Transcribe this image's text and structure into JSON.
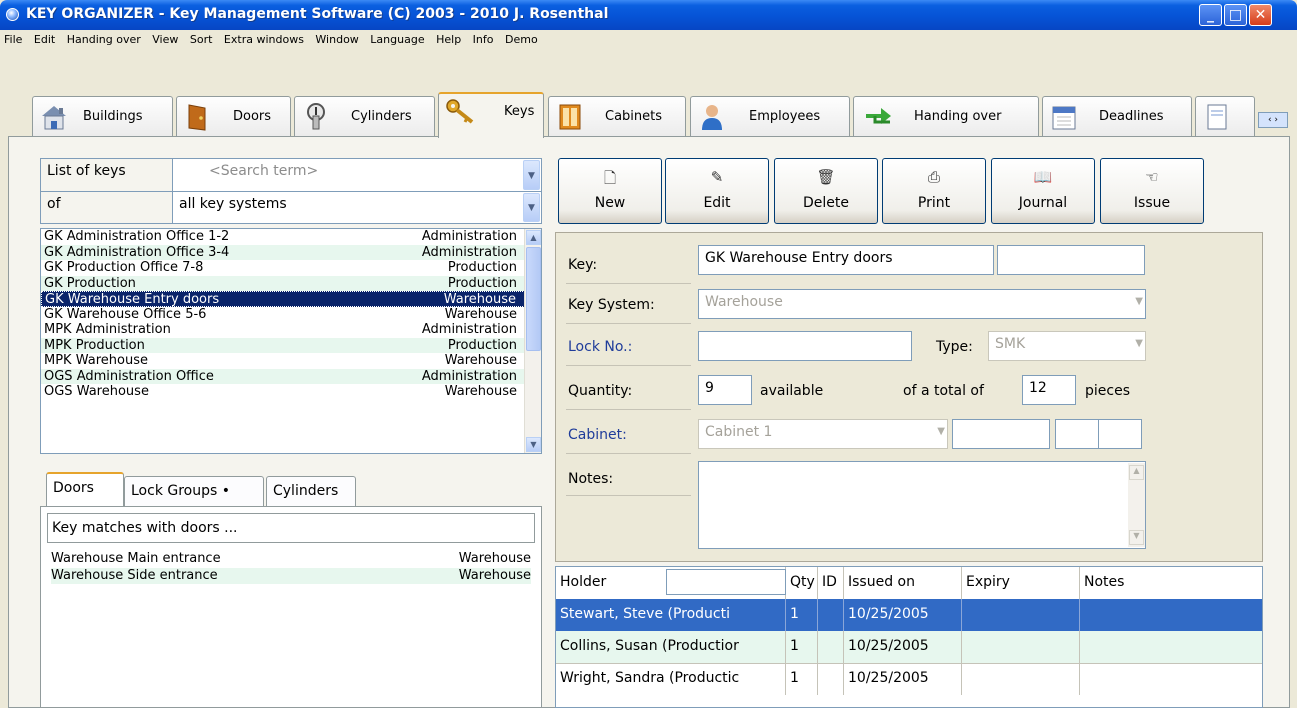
{
  "window": {
    "title": "KEY ORGANIZER  -  Key Management Software    (C) 2003 - 2010  J. Rosenthal",
    "controls": [
      "minimize",
      "maximize",
      "close"
    ]
  },
  "menu": [
    "File",
    "Edit",
    "Handing over",
    "View",
    "Sort",
    "Extra windows",
    "Window",
    "Language",
    "Help",
    "Info",
    "Demo"
  ],
  "tabs": [
    {
      "label": "Buildings",
      "icon": "building-icon"
    },
    {
      "label": "Doors",
      "icon": "door-icon"
    },
    {
      "label": "Cylinders",
      "icon": "cylinder-icon"
    },
    {
      "label": "Keys",
      "icon": "key-icon",
      "active": true
    },
    {
      "label": "Cabinets",
      "icon": "cabinet-icon"
    },
    {
      "label": "Employees",
      "icon": "employee-icon"
    },
    {
      "label": "Handing over",
      "icon": "handover-icon"
    },
    {
      "label": "Deadlines",
      "icon": "calendar-icon"
    }
  ],
  "tab_scroll": "‹ ›",
  "list": {
    "label": "List of keys",
    "search_placeholder": "<Search term>",
    "of_label": "of",
    "of_value": "all key systems",
    "items": [
      {
        "name": "GK Administration Office 1-2",
        "system": "Administration"
      },
      {
        "name": "GK Administration Office 3-4",
        "system": "Administration"
      },
      {
        "name": "GK Production Office 7-8",
        "system": "Production"
      },
      {
        "name": "GK Production",
        "system": "Production"
      },
      {
        "name": "GK Warehouse Entry doors",
        "system": "Warehouse",
        "selected": true
      },
      {
        "name": "GK Warehouse Office 5-6",
        "system": "Warehouse"
      },
      {
        "name": "MPK Administration",
        "system": "Administration"
      },
      {
        "name": "MPK Production",
        "system": "Production"
      },
      {
        "name": "MPK Warehouse",
        "system": "Warehouse"
      },
      {
        "name": "OGS Administration Office",
        "system": "Administration"
      },
      {
        "name": "OGS Warehouse",
        "system": "Warehouse"
      }
    ]
  },
  "subtabs": {
    "doors": "Doors",
    "lock_groups": "Lock Groups •",
    "cylinders": "Cylinders",
    "header": "Key matches with doors ...",
    "rows": [
      {
        "name": "Warehouse Main entrance",
        "system": "Warehouse"
      },
      {
        "name": "Warehouse Side entrance",
        "system": "Warehouse"
      }
    ]
  },
  "toolbar": {
    "new": "New",
    "edit": "Edit",
    "delete": "Delete",
    "print": "Print",
    "journal": "Journal",
    "issue": "Issue"
  },
  "details": {
    "key_label": "Key:",
    "key_value": "GK Warehouse Entry doors",
    "key_extra": "",
    "system_label": "Key System:",
    "system_value": "Warehouse",
    "lock_label": "Lock No.:",
    "lock_value": "",
    "type_label": "Type:",
    "type_value": "SMK",
    "qty_label": "Quantity:",
    "qty_value": "9",
    "available": "available",
    "total_label": "of a total of",
    "total_value": "12",
    "pieces": "pieces",
    "cabinet_label": "Cabinet:",
    "cabinet_value": "Cabinet 1",
    "notes_label": "Notes:",
    "notes_value": ""
  },
  "holders": {
    "columns": [
      "Holder",
      "Qty",
      "ID",
      "Issued on",
      "Expiry",
      "Notes"
    ],
    "rows": [
      {
        "holder": "Stewart, Steve (Producti",
        "qty": "1",
        "id": "",
        "issued": "10/25/2005",
        "expiry": "",
        "notes": "",
        "selected": true
      },
      {
        "holder": "Collins, Susan (Productior",
        "qty": "1",
        "id": "",
        "issued": "10/25/2005",
        "expiry": "",
        "notes": ""
      },
      {
        "holder": "Wright, Sandra (Productic",
        "qty": "1",
        "id": "",
        "issued": "10/25/2005",
        "expiry": "",
        "notes": ""
      }
    ]
  },
  "colors": {
    "titlebar": "#0653d6",
    "selection": "#0a246a",
    "row_selection": "#316ac5",
    "alt_row": "#e7f7ee",
    "tab_accent": "#e6a42c"
  }
}
